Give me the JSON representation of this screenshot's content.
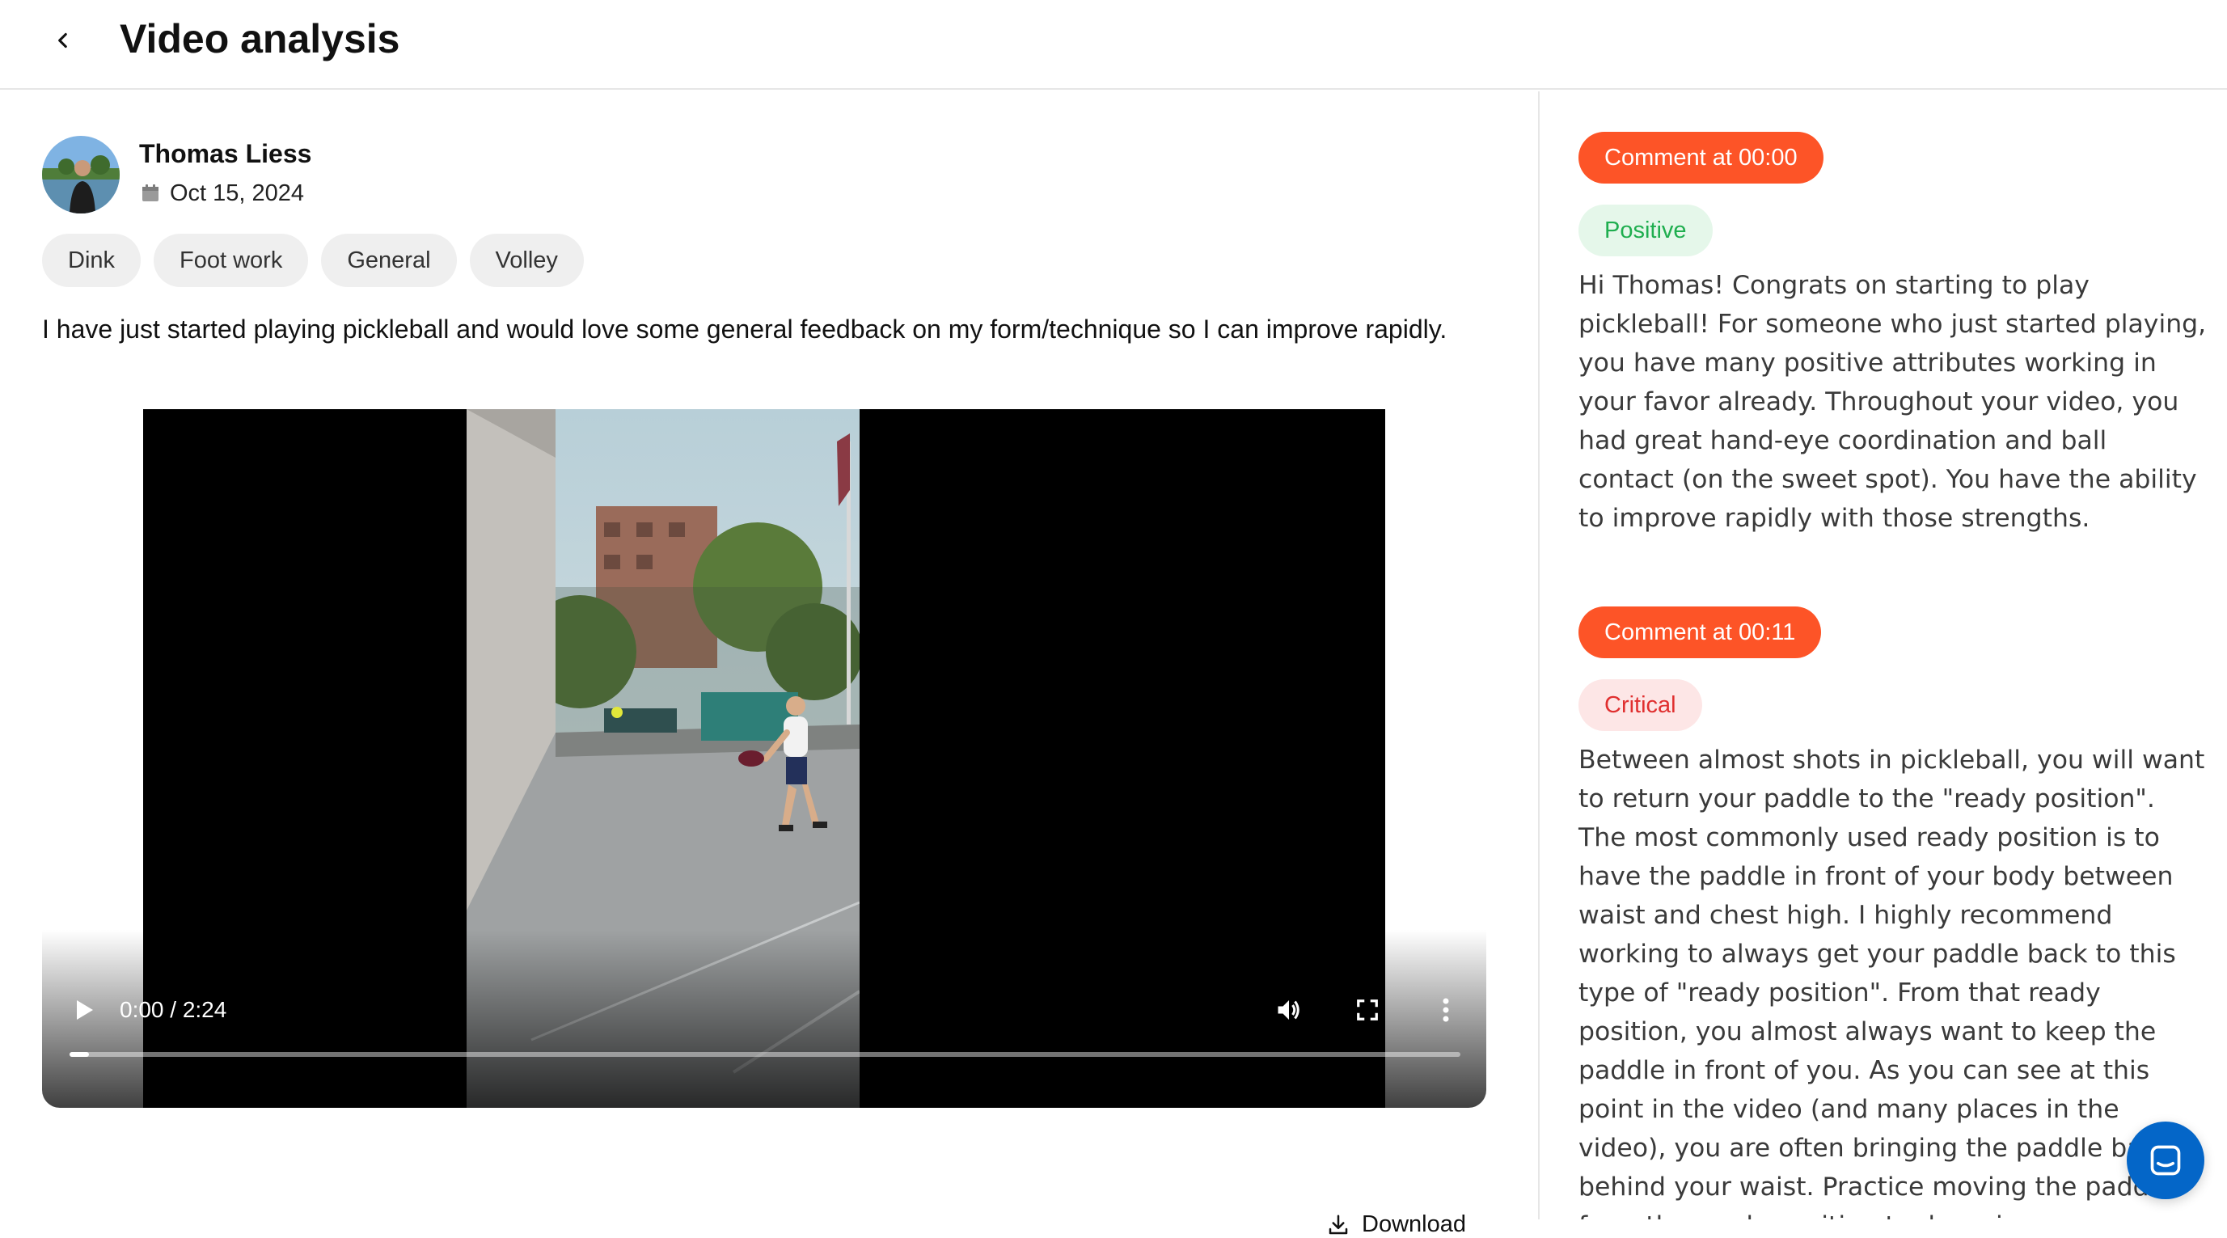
{
  "header": {
    "title": "Video analysis",
    "back_icon": "chevron-left-icon"
  },
  "submission": {
    "user_name": "Thomas Liess",
    "date": "Oct 15, 2024",
    "tags": [
      "Dink",
      "Foot work",
      "General",
      "Volley"
    ],
    "description": "I have just started playing pickleball and would love some general feedback on my form/technique so I can improve rapidly."
  },
  "video": {
    "time_display": "0:00 / 2:24",
    "progress": 0.0,
    "download_label": "Download"
  },
  "comments": [
    {
      "time_label": "Comment at 00:00",
      "sentiment": "Positive",
      "text": "Hi Thomas! Congrats on starting to play pickleball! For someone who just started playing, you have many positive attributes working in your favor already. Throughout your video, you had great hand-eye coordination and ball contact (on the sweet spot). You have the ability to improve rapidly with those strengths."
    },
    {
      "time_label": "Comment at 00:11",
      "sentiment": "Critical",
      "text": "Between almost shots in pickleball, you will want to return your paddle to the \"ready position\". The most commonly used ready position is to have the paddle in front of your body between waist and chest high. I highly recommend working to always get your paddle back to this type of \"ready position\". From that ready position, you almost always want to keep the paddle in front of you. As you can see at this point in the video (and many places in the video), you are often bringing the paddle back behind your waist. Practice moving the paddle from the ready position to down in"
    }
  ],
  "colors": {
    "accent": "#fd5427",
    "positive_bg": "#e5f7ea",
    "positive_text": "#1fae4f",
    "critical_bg": "#fde6e6",
    "critical_text": "#e02f2f",
    "chat_button": "#0466c8"
  }
}
